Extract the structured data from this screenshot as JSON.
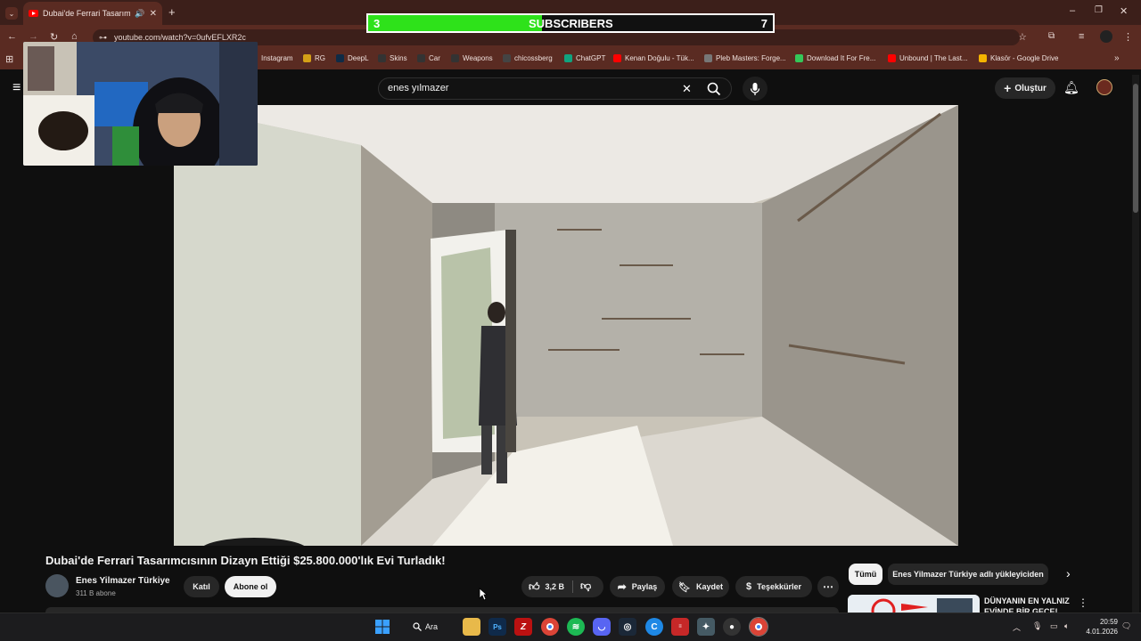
{
  "browser": {
    "tab_title": "Dubai'de Ferrari Tasarımcıs",
    "url": "youtube.com/watch?v=0ufvEFLXR2c",
    "bookmarks": [
      {
        "label": "Instagram",
        "color": "#d62976"
      },
      {
        "label": "RG",
        "color": "#d4a017"
      },
      {
        "label": "DeepL",
        "color": "#0f2b46"
      },
      {
        "label": "Skins",
        "color": "#333333"
      },
      {
        "label": "Car",
        "color": "#333333"
      },
      {
        "label": "Weapons",
        "color": "#333333"
      },
      {
        "label": "chicossberg",
        "color": "#444444"
      },
      {
        "label": "ChatGPT",
        "color": "#10a37f"
      },
      {
        "label": "Kenan Doğulu - Tük...",
        "color": "#ff0000"
      },
      {
        "label": "Pleb Masters: Forge...",
        "color": "#777777"
      },
      {
        "label": "Download It For Fre...",
        "color": "#34c759"
      },
      {
        "label": "Unbound | The Last...",
        "color": "#ff0000"
      },
      {
        "label": "Klasör - Google Drive",
        "color": "#f4b400"
      }
    ]
  },
  "overlay": {
    "left_count": "3",
    "label": "SUBSCRIBERS",
    "right_count": "7",
    "progress": 0.43
  },
  "youtube": {
    "search_value": "enes yılmazer",
    "create_label": "Oluştur",
    "video_title": "Dubai'de Ferrari Tasarımcısının Dizayn Ettiği $25.800.000'lık Evi Turladık!",
    "channel_name": "Enes Yilmazer Türkiye",
    "subscriber_count": "311 B abone",
    "join_label": "Katıl",
    "subscribe_label": "Abone ol",
    "like_count": "3,2 B",
    "share_label": "Paylaş",
    "save_label": "Kaydet",
    "thanks_label": "Teşekkürler",
    "chips": [
      "Tümü",
      "Enes Yilmazer Türkiye adlı yükleyiciden"
    ],
    "related_title": "DÜNYANIN EN YALNIZ EVİNDE BİR GECE!"
  },
  "taskbar": {
    "search_label": "Ara",
    "time": "20:59",
    "date": "4.01.2026"
  },
  "colors": {
    "accent": "#2ee21a",
    "chrome": "#5a2b22",
    "yt_red": "#ff0000"
  }
}
